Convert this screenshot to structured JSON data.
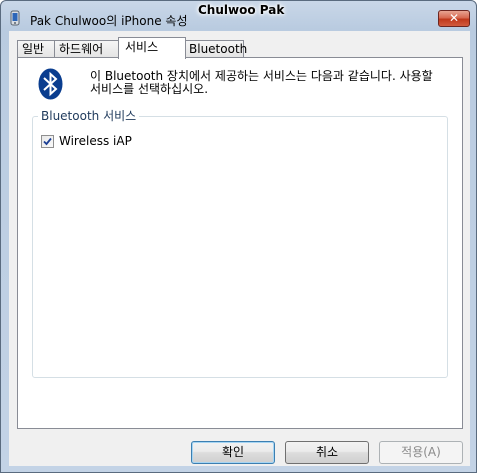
{
  "window": {
    "title": "Pak Chulwoo의 iPhone 속성",
    "user_name_overlay": "Chulwoo Pak",
    "close_glyph": "✕",
    "app_icon": "bluetooth-device-icon"
  },
  "tabs": [
    {
      "label": "일반",
      "active": false
    },
    {
      "label": "하드웨어",
      "active": false
    },
    {
      "label": "서비스",
      "active": true
    },
    {
      "label": "Bluetooth",
      "active": false
    }
  ],
  "services_page": {
    "logo_icon": "bluetooth-logo-icon",
    "intro_text_line1": "이 Bluetooth 장치에서 제공하는 서비스는 다음과 같습니다. 사용할",
    "intro_text_line2": "서비스를 선택하십시오.",
    "group_label": "Bluetooth 서비스",
    "services": [
      {
        "label": "Wireless iAP",
        "checked": true
      }
    ]
  },
  "buttons": {
    "ok": "확인",
    "cancel": "취소",
    "apply": "적용(A)"
  },
  "colors": {
    "bluetooth_blue": "#0a3d8f",
    "close_red": "#c0391c"
  }
}
